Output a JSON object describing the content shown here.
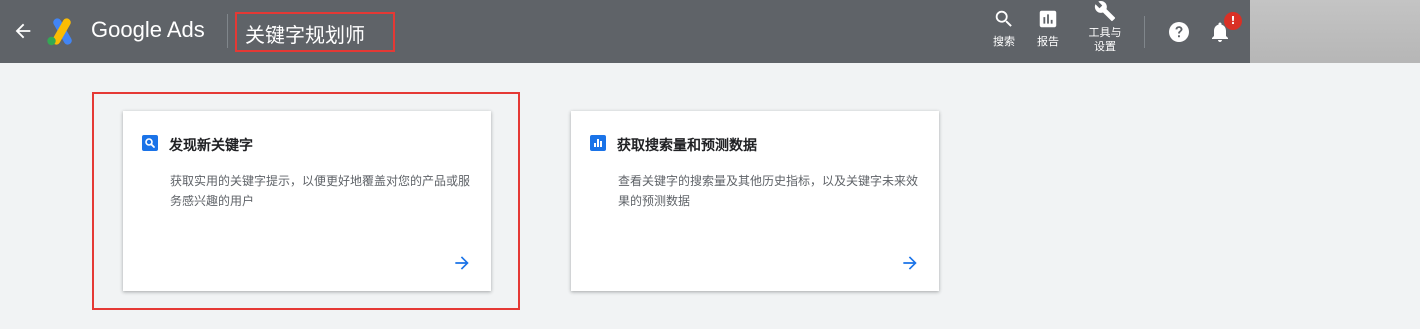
{
  "header": {
    "brand": "Google Ads",
    "page_title": "关键字规划师",
    "tools": {
      "search": "搜索",
      "report": "报告",
      "settings_line1": "工具与",
      "settings_line2": "设置"
    },
    "notification_badge": "!"
  },
  "cards": [
    {
      "title": "发现新关键字",
      "description": "获取实用的关键字提示，以便更好地覆盖对您的产品或服务感兴趣的用户",
      "icon": "search-icon"
    },
    {
      "title": "获取搜索量和预测数据",
      "description": "查看关键字的搜索量及其他历史指标，以及关键字未来效果的预测数据",
      "icon": "bar-chart-icon"
    }
  ],
  "colors": {
    "topbar": "#5f6368",
    "accent_blue": "#1a73e8",
    "highlight_red": "#e53935",
    "page_bg": "#f1f3f4"
  }
}
